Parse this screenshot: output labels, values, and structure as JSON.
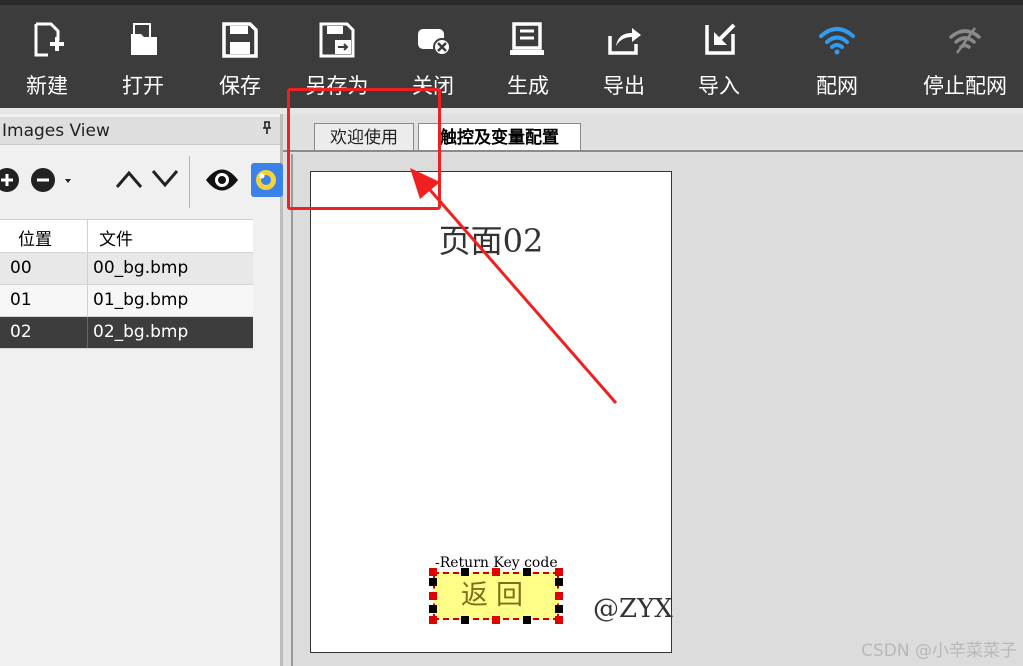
{
  "toolbar": {
    "items": [
      {
        "label": "新建",
        "icon": "new-file-icon"
      },
      {
        "label": "打开",
        "icon": "open-folder-icon"
      },
      {
        "label": "保存",
        "icon": "save-icon"
      },
      {
        "label": "另存为",
        "icon": "save-as-icon"
      },
      {
        "label": "关闭",
        "icon": "close-icon"
      },
      {
        "label": "生成",
        "icon": "generate-icon"
      },
      {
        "label": "导出",
        "icon": "export-icon"
      },
      {
        "label": "导入",
        "icon": "import-icon"
      },
      {
        "label": "配网",
        "icon": "wifi-icon"
      },
      {
        "label": "停止配网",
        "icon": "wifi-off-icon"
      }
    ]
  },
  "images_view": {
    "title": "Images View",
    "pin": "𝌀",
    "columns": [
      "位置",
      "文件"
    ],
    "rows": [
      {
        "pos": "00",
        "file": "00_bg.bmp"
      },
      {
        "pos": "01",
        "file": "01_bg.bmp"
      },
      {
        "pos": "02",
        "file": "02_bg.bmp",
        "selected": true
      }
    ]
  },
  "tabs": [
    {
      "label": "欢迎使用"
    },
    {
      "label": "触控及变量配置",
      "active": true
    }
  ],
  "canvas": {
    "page_title": "页面02",
    "return_label": "-Return Key code",
    "return_button": "返回",
    "signature": "@ZYX"
  },
  "watermark": "CSDN @小辛菜菜子",
  "colors": {
    "toolbar_bg": "#3c3c3c",
    "wifi_active": "#2f9cf2",
    "selected_row": "#3d3d3d",
    "highlight_red": "#f02020",
    "button_fill": "#ffff88"
  }
}
